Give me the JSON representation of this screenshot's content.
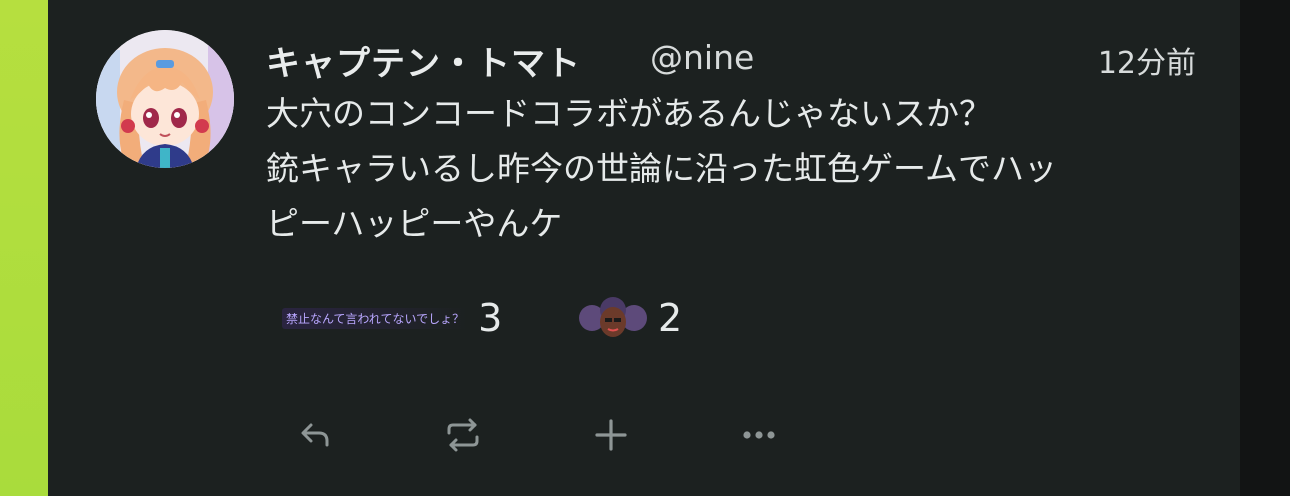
{
  "post": {
    "display_name": "キャプテン・トマト",
    "handle": "@nine",
    "timestamp": "12分前",
    "lines": [
      "大穴のコンコードコラボがあるんじゃないスか？",
      "銃キャラいるし昨今の世論に沿った虹色ゲームでハッ",
      "ピーハッピーやんケ"
    ]
  },
  "reactions": [
    {
      "emoji_text": "禁止なんて言われてないでしょ？",
      "count": "3"
    },
    {
      "emoji_icon": "afro-face-emoji",
      "count": "2"
    }
  ],
  "actions": {
    "reply_icon": "reply-icon",
    "renote_icon": "repeat-icon",
    "react_icon": "plus-icon",
    "more_icon": "more-icon"
  },
  "colors": {
    "accent_left": "#b6df3f",
    "background": "#1c2120",
    "text": "#e6eaea"
  }
}
